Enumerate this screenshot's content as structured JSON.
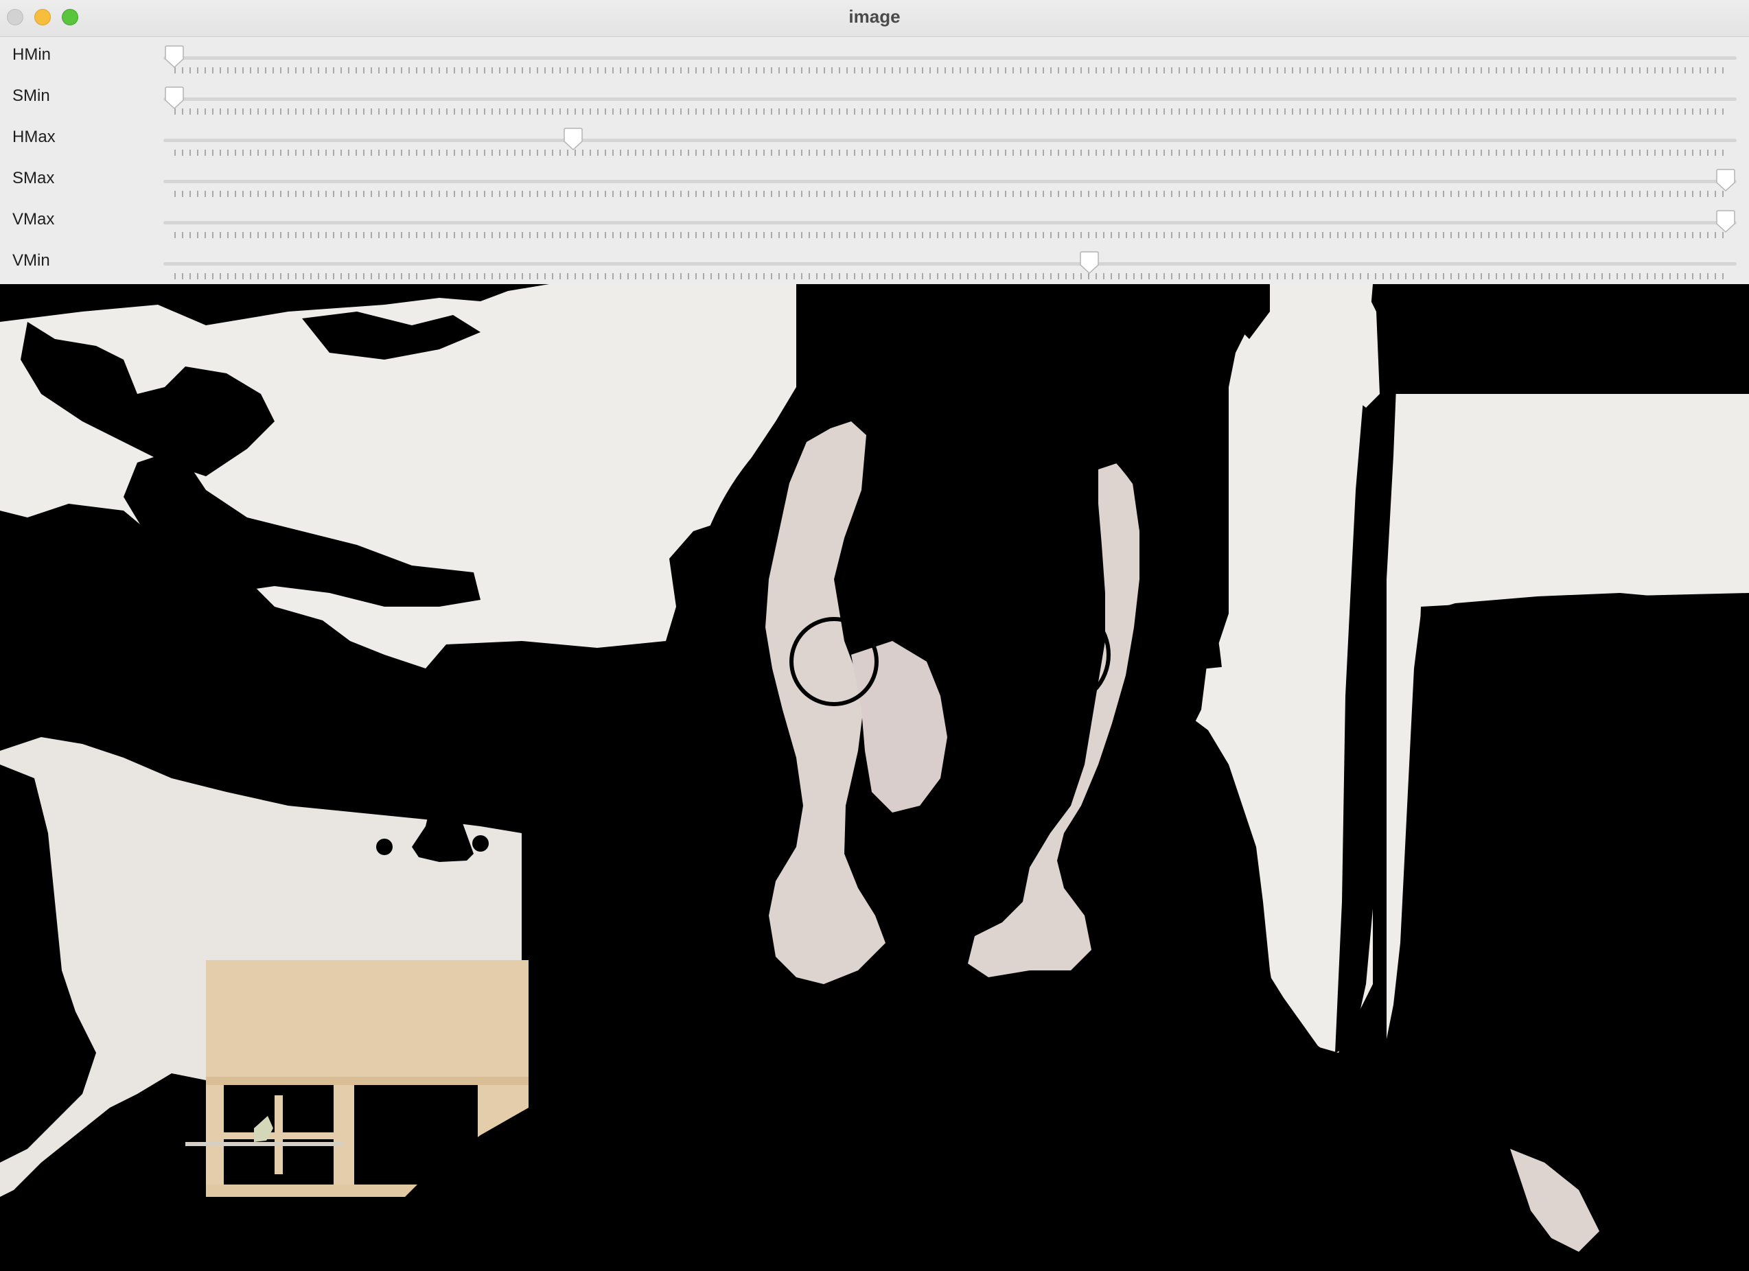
{
  "window": {
    "title": "image"
  },
  "trackbars": [
    {
      "label": "HMin",
      "value_fraction": 0.0
    },
    {
      "label": "SMin",
      "value_fraction": 0.0
    },
    {
      "label": "HMax",
      "value_fraction": 0.257
    },
    {
      "label": "SMax",
      "value_fraction": 1.0
    },
    {
      "label": "VMax",
      "value_fraction": 1.0
    },
    {
      "label": "VMin",
      "value_fraction": 0.59
    }
  ],
  "colors": {
    "masked_background": "#000000",
    "visible_wall": "#efedea",
    "visible_skin": "#ddd3cf",
    "shelf_wood": "#e4cdaa",
    "close_button": "#d2d2d2",
    "minimize_button": "#f6be3c",
    "zoom_button": "#5ac43e"
  }
}
